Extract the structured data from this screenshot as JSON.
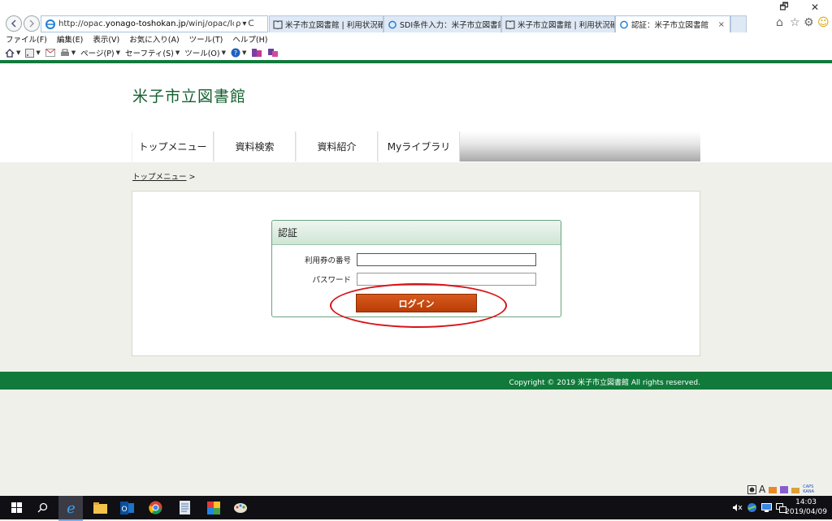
{
  "browser": {
    "url_prefix": "http://opac.",
    "url_host": "yonago-toshokan.jp",
    "url_path": "/winj/opac/login.do?lang",
    "search_glyph": "ρ",
    "addr_dropdown": "▾",
    "refresh_glyph": "ᑕ",
    "tabs": [
      {
        "label": "米子市立図書館 | 利用状況確認",
        "icon": "book-icon"
      },
      {
        "label": "SDI条件入力：米子市立図書館",
        "icon": "ie-page-icon"
      },
      {
        "label": "米子市立図書館 | 利用状況確認",
        "icon": "book-icon"
      },
      {
        "label": "認証：米子市立図書館",
        "icon": "ie-page-icon",
        "close": "×"
      }
    ],
    "menu": [
      "ファイル(F)",
      "編集(E)",
      "表示(V)",
      "お気に入り(A)",
      "ツール(T)",
      "ヘルプ(H)"
    ],
    "commands": {
      "page": "ページ(P)",
      "safety": "セーフティ(S)",
      "tools": "ツール(O)"
    },
    "window": {
      "restore": "🗗",
      "close": "✕"
    },
    "right_tools": {
      "home": "⌂",
      "star": "☆",
      "gear": "⚙",
      "smile": "☺"
    }
  },
  "site": {
    "title": "米子市立図書館",
    "nav": [
      "トップメニュー",
      "資料検索",
      "資料紹介",
      "Myライブラリ"
    ],
    "breadcrumb": {
      "link": "トップメニュー",
      "sep": ">"
    }
  },
  "auth": {
    "heading": "認証",
    "card_label": "利用券の番号",
    "password_label": "パスワード",
    "card_value": "",
    "password_value": "",
    "login_button": "ログイン"
  },
  "footer": {
    "copyright": "Copyright © 2019 米子市立図書館 All rights reserved."
  },
  "taskbar": {
    "time": "14:03",
    "date": "2019/04/09",
    "ime": "A",
    "caps": "CAPS",
    "kana": "KANA"
  },
  "colors": {
    "accent_green": "#117a3b",
    "login_orange": "#c84a10",
    "highlight_red": "#d8141a"
  }
}
